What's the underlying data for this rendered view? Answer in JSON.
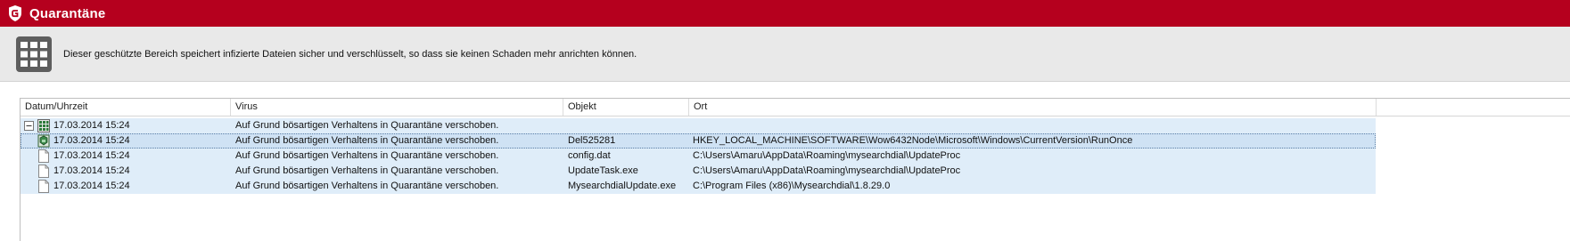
{
  "window": {
    "title": "Quarantäne"
  },
  "info": {
    "text": "Dieser geschützte Bereich speichert infizierte Dateien sicher und verschlüsselt, so dass sie keinen Schaden mehr anrichten können."
  },
  "columns": [
    "Datum/Uhrzeit",
    "Virus",
    "Objekt",
    "Ort"
  ],
  "rows": [
    {
      "date": "17.03.2014 15:24",
      "virus": "Auf Grund bösartigen Verhaltens in Quarantäne verschoben.",
      "object": "",
      "location": "",
      "icon": "group-icon",
      "expander": "⊟"
    },
    {
      "date": "17.03.2014 15:24",
      "virus": "Auf Grund bösartigen Verhaltens in Quarantäne verschoben.",
      "object": "Del525281",
      "location": "HKEY_LOCAL_MACHINE\\SOFTWARE\\Wow6432Node\\Microsoft\\Windows\\CurrentVersion\\RunOnce",
      "icon": "registry-icon"
    },
    {
      "date": "17.03.2014 15:24",
      "virus": "Auf Grund bösartigen Verhaltens in Quarantäne verschoben.",
      "object": "config.dat",
      "location": "C:\\Users\\Amaru\\AppData\\Roaming\\mysearchdial\\UpdateProc",
      "icon": "file-icon"
    },
    {
      "date": "17.03.2014 15:24",
      "virus": "Auf Grund bösartigen Verhaltens in Quarantäne verschoben.",
      "object": "UpdateTask.exe",
      "location": "C:\\Users\\Amaru\\AppData\\Roaming\\mysearchdial\\UpdateProc",
      "icon": "file-icon"
    },
    {
      "date": "17.03.2014 15:24",
      "virus": "Auf Grund bösartigen Verhaltens in Quarantäne verschoben.",
      "object": "MysearchdialUpdate.exe",
      "location": "C:\\Program Files (x86)\\Mysearchdial\\1.8.29.0",
      "icon": "file-icon"
    }
  ],
  "colors": {
    "brand": "#b5001e",
    "row_bg": "#dfedf9",
    "selected_bg": "#cfe2f4"
  }
}
